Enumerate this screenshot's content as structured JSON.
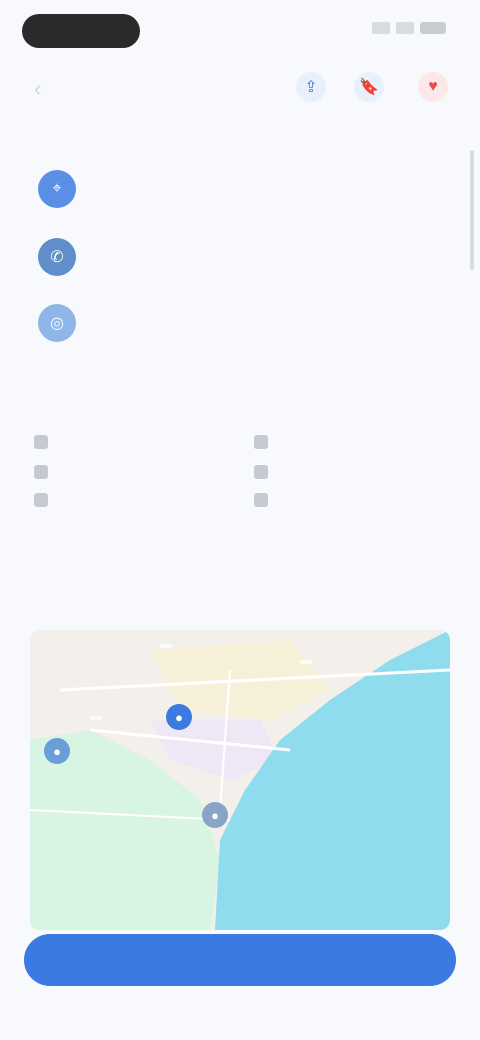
{
  "header": {
    "back_icon": "back-arrow-icon",
    "title": "",
    "icons": [
      "share-icon",
      "bookmark-icon",
      "heart-icon"
    ]
  },
  "contact_section": {
    "title": "",
    "items": [
      {
        "icon": "location-icon",
        "label": "",
        "value": ""
      },
      {
        "icon": "phone-icon",
        "label": "",
        "value": ""
      },
      {
        "icon": "website-icon",
        "label": "",
        "value": ""
      }
    ]
  },
  "amenities_section": {
    "title": "",
    "left": [
      {
        "icon": "wifi-icon",
        "label": ""
      },
      {
        "icon": "parking-icon",
        "label": ""
      },
      {
        "icon": "pet-icon",
        "label": ""
      }
    ],
    "right": [
      {
        "icon": "pool-icon",
        "label": ""
      },
      {
        "icon": "restaurant-icon",
        "label": ""
      },
      {
        "icon": "gym-icon",
        "label": ""
      }
    ],
    "more_link": ""
  },
  "map_section": {
    "title": "",
    "labels": [
      "",
      "",
      ""
    ]
  },
  "cta": {
    "label": ""
  },
  "bottom_nav": [
    "",
    "",
    ""
  ],
  "colors": {
    "accent": "#3b7ae0",
    "red": "#e05252",
    "sea": "#8fdcef",
    "land_green": "#d6f5e0"
  }
}
